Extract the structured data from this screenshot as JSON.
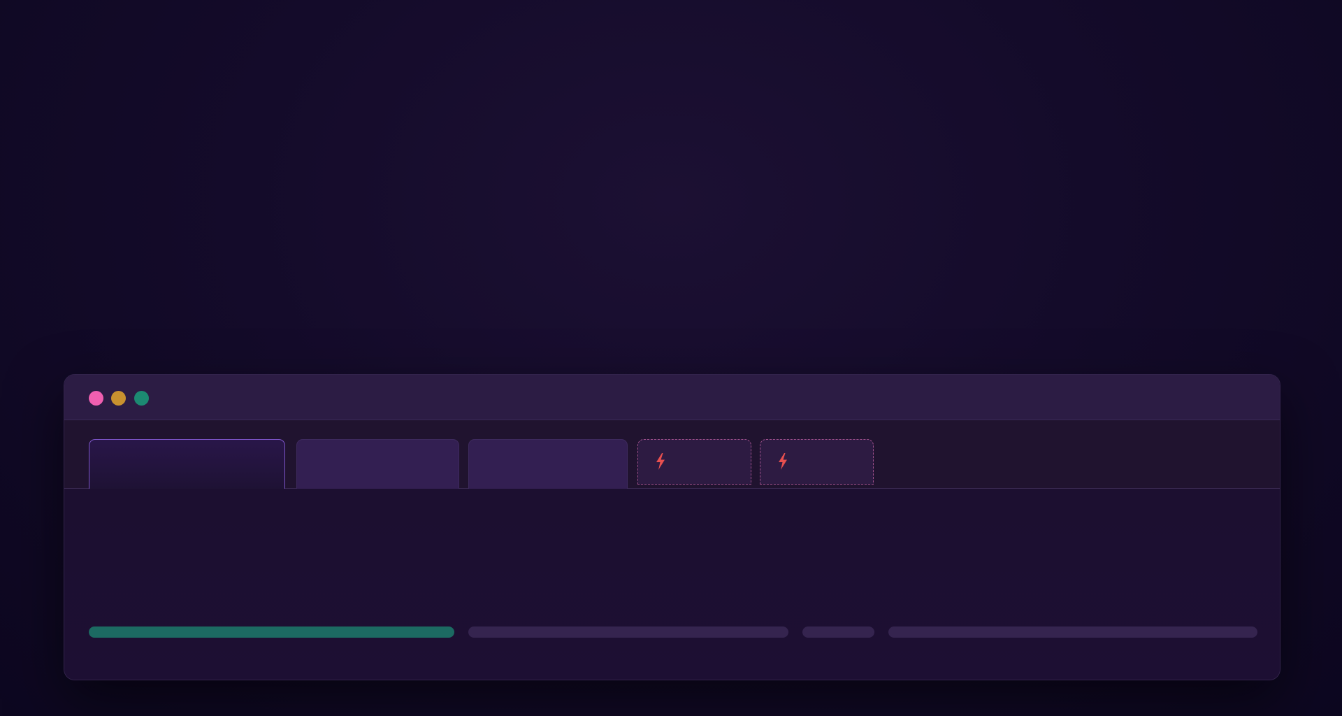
{
  "window": {
    "controls": [
      {
        "name": "close",
        "color": "#ef5fb0"
      },
      {
        "name": "minimize",
        "color": "#c9912f"
      },
      {
        "name": "maximize",
        "color": "#1c8a72"
      }
    ]
  },
  "tabs": [
    {
      "label": "",
      "state": "active"
    },
    {
      "label": "",
      "state": "normal"
    },
    {
      "label": "",
      "state": "normal"
    },
    {
      "label": "",
      "state": "pending",
      "icon": "lightning-bolt-icon",
      "icon_color": "#e8504f"
    },
    {
      "label": "",
      "state": "pending",
      "icon": "lightning-bolt-icon",
      "icon_color": "#e8504f"
    }
  ],
  "content": {
    "bars": [
      {
        "color": "#1c6a62"
      },
      {
        "color": "#35244f"
      },
      {
        "color": "#35244f"
      },
      {
        "color": "#35244f"
      }
    ]
  },
  "colors": {
    "accent": "#7d55c8",
    "warning": "#e8504f",
    "background": "#120a26"
  }
}
